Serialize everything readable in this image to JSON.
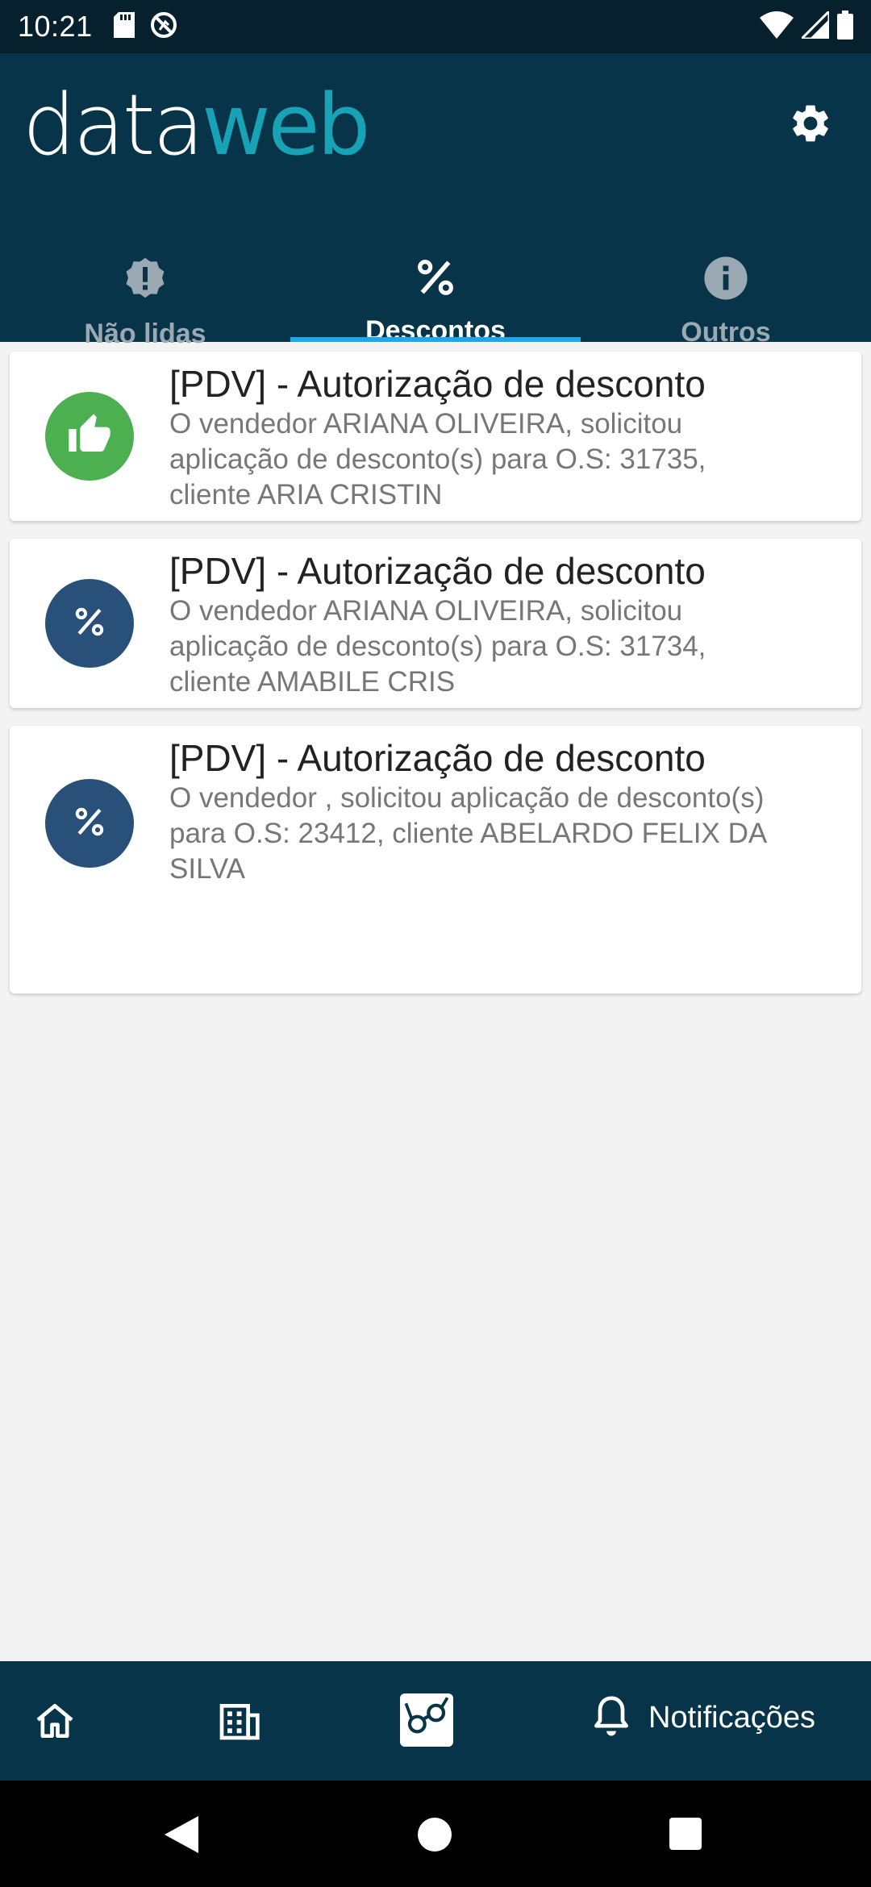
{
  "status_bar": {
    "time": "10:21",
    "icons": [
      "sd-card-icon",
      "do-not-disturb-icon",
      "wifi-icon",
      "signal-icon",
      "battery-icon"
    ]
  },
  "header": {
    "logo_part1": "data",
    "logo_part2": "web",
    "settings_icon": "gear-icon"
  },
  "tabs": [
    {
      "label": "Não lidas",
      "icon": "alert-icon",
      "active": false
    },
    {
      "label": "Descontos",
      "icon": "percent-icon",
      "active": true
    },
    {
      "label": "Outros",
      "icon": "info-icon",
      "active": false
    }
  ],
  "notifications": [
    {
      "title": "[PDV] - Autorização de desconto",
      "body_lines": [
        "O vendedor ARIANA OLIVEIRA, solicitou",
        "aplicação de desconto(s) para O.S: 31735,",
        "cliente ARIA CRISTIN"
      ],
      "icon": "thumbs-up-icon",
      "icon_color": "#4caf50"
    },
    {
      "title": "[PDV] - Autorização de desconto",
      "body_lines": [
        "O vendedor ARIANA OLIVEIRA, solicitou",
        "aplicação de desconto(s) para O.S: 31734,",
        "cliente AMABILE CRIS"
      ],
      "icon": "percent-icon",
      "icon_color": "#285079"
    },
    {
      "title": "[PDV] - Autorização de desconto",
      "body_lines": [
        "O vendedor , solicitou aplicação de desconto(s)",
        "para O.S: 23412, cliente ABELARDO FELIX DA",
        "SILVA"
      ],
      "icon": "percent-icon",
      "icon_color": "#285079"
    }
  ],
  "bottom_nav": {
    "items": [
      "home-icon",
      "building-icon",
      "glasses-icon",
      "bell-icon"
    ],
    "notifications_label": "Notificações"
  },
  "colors": {
    "header_bg": "#073449",
    "accent": "#1ea8e8",
    "logo_web": "#17a2b6",
    "logo_dot": "#f5a623"
  }
}
